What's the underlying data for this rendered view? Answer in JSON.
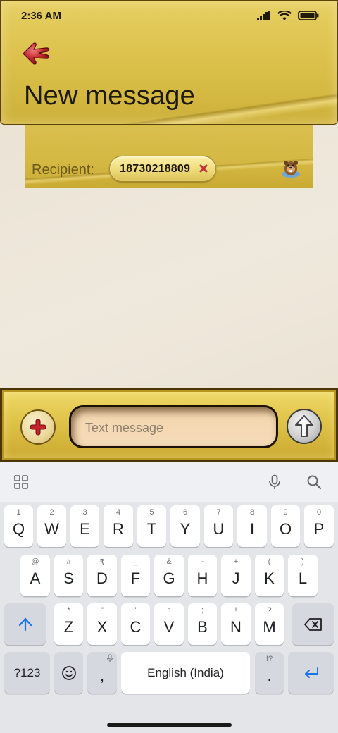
{
  "status_bar": {
    "time": "2:36 AM"
  },
  "header": {
    "title": "New message"
  },
  "recipient": {
    "label": "Recipient:",
    "chip_number": "18730218809"
  },
  "compose": {
    "placeholder": "Text message"
  },
  "keyboard": {
    "row1": [
      {
        "hint": "1",
        "key": "Q"
      },
      {
        "hint": "2",
        "key": "W"
      },
      {
        "hint": "3",
        "key": "E"
      },
      {
        "hint": "4",
        "key": "R"
      },
      {
        "hint": "5",
        "key": "T"
      },
      {
        "hint": "6",
        "key": "Y"
      },
      {
        "hint": "7",
        "key": "U"
      },
      {
        "hint": "8",
        "key": "I"
      },
      {
        "hint": "9",
        "key": "O"
      },
      {
        "hint": "0",
        "key": "P"
      }
    ],
    "row2": [
      {
        "hint": "@",
        "key": "A"
      },
      {
        "hint": "#",
        "key": "S"
      },
      {
        "hint": "₹",
        "key": "D"
      },
      {
        "hint": "_",
        "key": "F"
      },
      {
        "hint": "&",
        "key": "G"
      },
      {
        "hint": "-",
        "key": "H"
      },
      {
        "hint": "+",
        "key": "J"
      },
      {
        "hint": "(",
        "key": "K"
      },
      {
        "hint": ")",
        "key": "L"
      }
    ],
    "row3": [
      {
        "hint": "*",
        "key": "Z"
      },
      {
        "hint": "\"",
        "key": "X"
      },
      {
        "hint": "'",
        "key": "C"
      },
      {
        "hint": ":",
        "key": "V"
      },
      {
        "hint": ";",
        "key": "B"
      },
      {
        "hint": "!",
        "key": "N"
      },
      {
        "hint": "?",
        "key": "M"
      }
    ],
    "symbols_label": "?123",
    "comma": ",",
    "space_label": "English (India)",
    "period_hint": "!?",
    "period": "."
  }
}
